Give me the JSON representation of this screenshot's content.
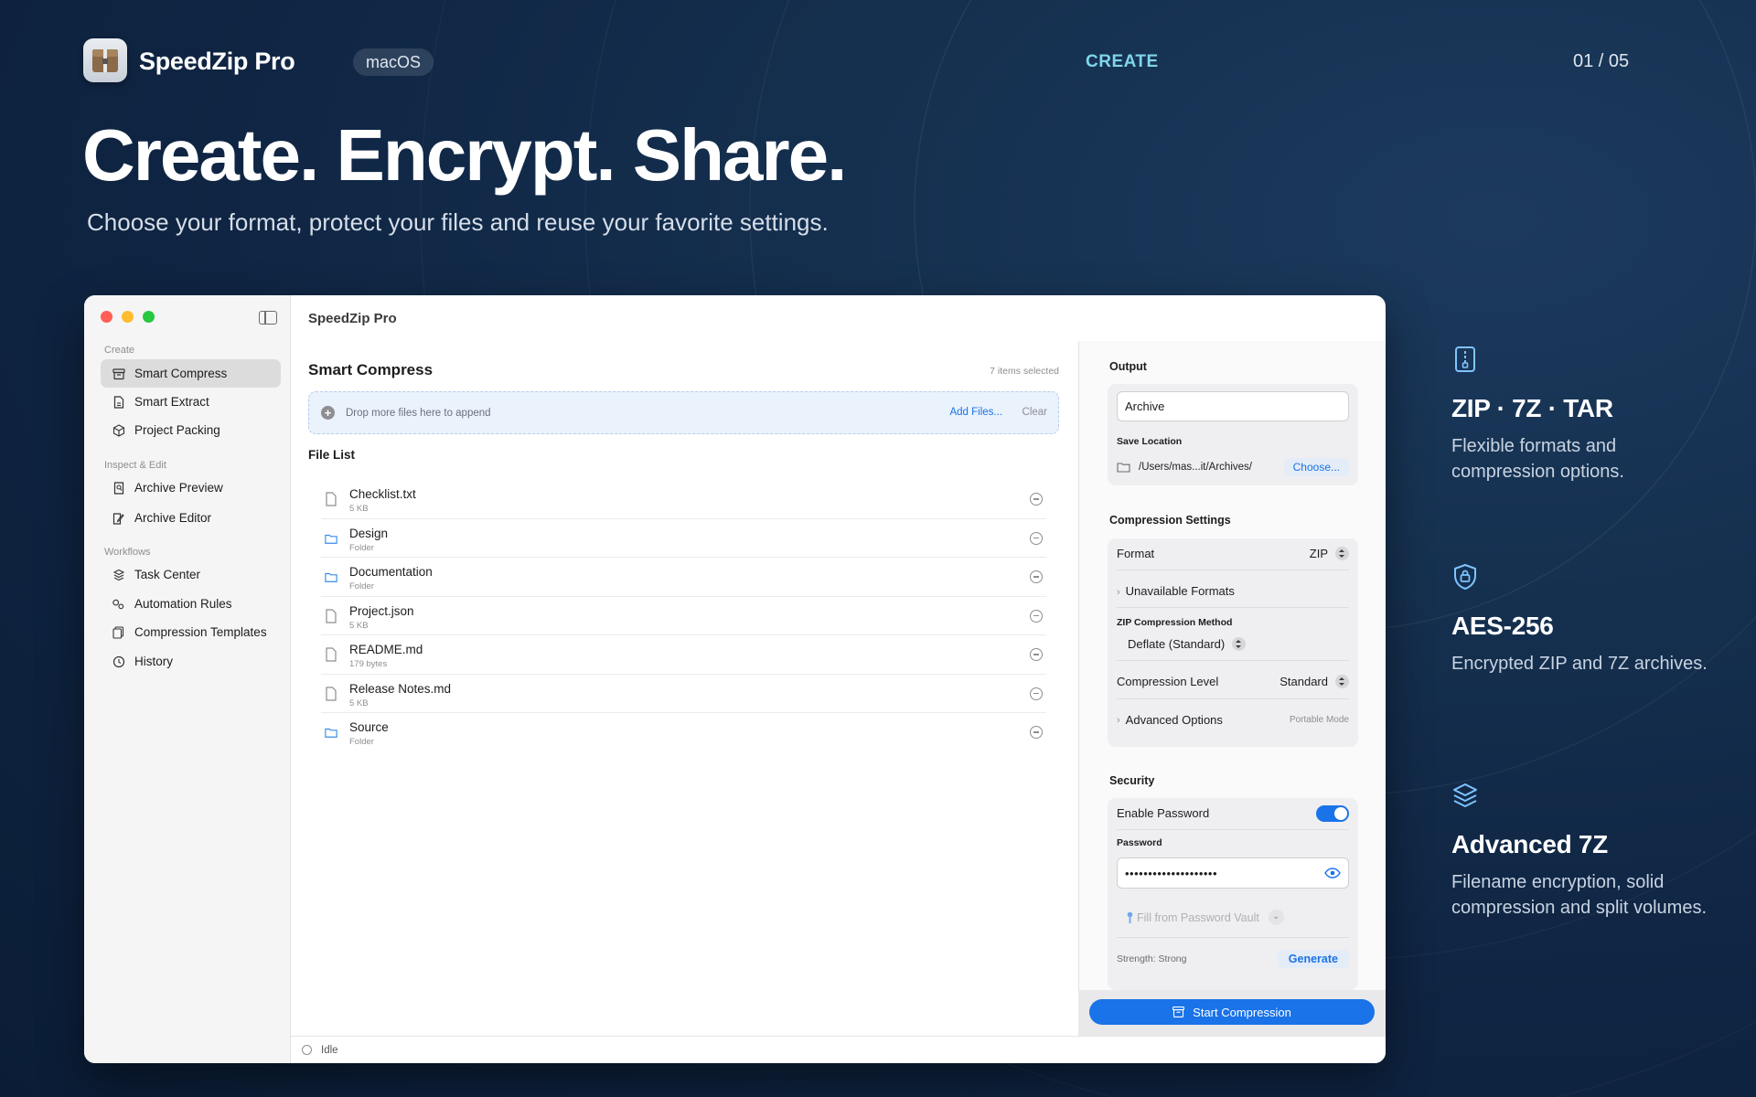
{
  "header": {
    "app_name": "SpeedZip Pro",
    "platform": "macOS",
    "section": "CREATE",
    "page": "01 / 05",
    "headline": "Create. Encrypt. Share.",
    "subheadline": "Choose your format, protect your files and reuse your favorite settings."
  },
  "window": {
    "title": "SpeedZip Pro",
    "sidebar": {
      "groups": [
        "Create",
        "Inspect & Edit",
        "Workflows"
      ],
      "items": [
        {
          "label": "Smart Compress",
          "icon": "archive-box-icon",
          "active": true
        },
        {
          "label": "Smart Extract",
          "icon": "document-icon"
        },
        {
          "label": "Project Packing",
          "icon": "cube-icon"
        },
        {
          "label": "Archive Preview",
          "icon": "document-search-icon"
        },
        {
          "label": "Archive Editor",
          "icon": "document-edit-icon"
        },
        {
          "label": "Task Center",
          "icon": "stack-icon"
        },
        {
          "label": "Automation Rules",
          "icon": "gears-icon"
        },
        {
          "label": "Compression Templates",
          "icon": "template-icon"
        },
        {
          "label": "History",
          "icon": "clock-icon"
        }
      ]
    },
    "main": {
      "title": "Smart Compress",
      "selection_count": "7 items selected",
      "dropzone": {
        "text": "Drop more files here to append",
        "add_label": "Add Files...",
        "clear_label": "Clear"
      },
      "list_title": "File List",
      "files": [
        {
          "name": "Checklist.txt",
          "meta": "5 KB",
          "kind": "file"
        },
        {
          "name": "Design",
          "meta": "Folder",
          "kind": "folder"
        },
        {
          "name": "Documentation",
          "meta": "Folder",
          "kind": "folder"
        },
        {
          "name": "Project.json",
          "meta": "5 KB",
          "kind": "file"
        },
        {
          "name": "README.md",
          "meta": "179 bytes",
          "kind": "file"
        },
        {
          "name": "Release Notes.md",
          "meta": "5 KB",
          "kind": "file"
        },
        {
          "name": "Source",
          "meta": "Folder",
          "kind": "folder"
        }
      ]
    },
    "status": "Idle",
    "inspector": {
      "output": {
        "heading": "Output",
        "archive_name": "Archive",
        "save_location_label": "Save Location",
        "save_path": "/Users/mas...it/Archives/",
        "choose_label": "Choose..."
      },
      "compression": {
        "heading": "Compression Settings",
        "format_label": "Format",
        "format_value": "ZIP",
        "unavailable_label": "Unavailable Formats",
        "method_label": "ZIP Compression Method",
        "method_value": "Deflate (Standard)",
        "level_label": "Compression Level",
        "level_value": "Standard",
        "advanced_label": "Advanced Options",
        "advanced_note": "Portable Mode"
      },
      "security": {
        "heading": "Security",
        "enable_password_label": "Enable Password",
        "enable_password": true,
        "password_label": "Password",
        "password_value": "••••••••••••••••••••",
        "vault_label": "Fill from Password Vault",
        "strength": "Strength: Strong",
        "generate_label": "Generate"
      },
      "start_label": "Start Compression"
    }
  },
  "features": [
    {
      "title": "ZIP · 7Z · TAR",
      "desc": "Flexible formats and compression options.",
      "icon": "zip-file-icon"
    },
    {
      "title": "AES-256",
      "desc": "Encrypted ZIP and 7Z archives.",
      "icon": "shield-lock-icon"
    },
    {
      "title": "Advanced 7Z",
      "desc": "Filename encryption, solid compression and split volumes.",
      "icon": "layers-icon"
    }
  ],
  "colors": {
    "accent": "#1a73e8",
    "section_label": "#7fd6e8",
    "background": "#0f2543"
  }
}
